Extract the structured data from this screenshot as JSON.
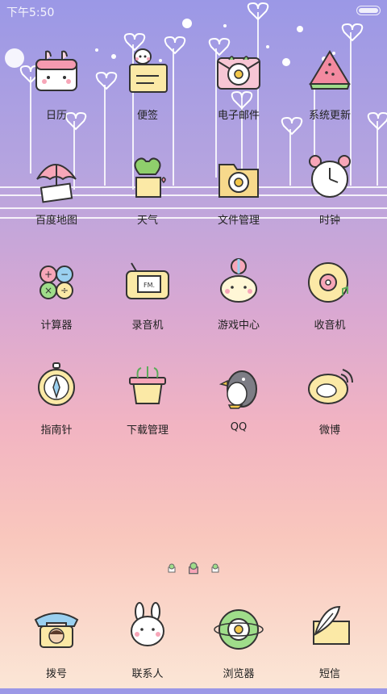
{
  "status_bar": {
    "time": "下午5:50"
  },
  "apps": [
    {
      "id": "calendar",
      "label": "日历",
      "icon": "calendar-icon"
    },
    {
      "id": "notes",
      "label": "便签",
      "icon": "notes-icon"
    },
    {
      "id": "email",
      "label": "电子邮件",
      "icon": "email-icon"
    },
    {
      "id": "system-update",
      "label": "系统更新",
      "icon": "watermelon-icon"
    },
    {
      "id": "baidu-map",
      "label": "百度地图",
      "icon": "umbrella-map-icon"
    },
    {
      "id": "weather",
      "label": "天气",
      "icon": "cactus-icon"
    },
    {
      "id": "file-manager",
      "label": "文件管理",
      "icon": "folder-icon"
    },
    {
      "id": "clock",
      "label": "时钟",
      "icon": "alarm-clock-icon"
    },
    {
      "id": "calculator",
      "label": "计算器",
      "icon": "calculator-icon"
    },
    {
      "id": "recorder",
      "label": "录音机",
      "icon": "radio-icon"
    },
    {
      "id": "game-center",
      "label": "游戏中心",
      "icon": "seal-ball-icon"
    },
    {
      "id": "radio",
      "label": "收音机",
      "icon": "cd-icon"
    },
    {
      "id": "compass",
      "label": "指南针",
      "icon": "compass-icon"
    },
    {
      "id": "download-manager",
      "label": "下载管理",
      "icon": "plant-pot-icon"
    },
    {
      "id": "qq",
      "label": "QQ",
      "icon": "penguin-icon"
    },
    {
      "id": "weibo",
      "label": "微博",
      "icon": "weibo-icon"
    }
  ],
  "dock": [
    {
      "id": "dialer",
      "label": "拨号",
      "icon": "phone-icon"
    },
    {
      "id": "contacts",
      "label": "联系人",
      "icon": "bunny-icon"
    },
    {
      "id": "browser",
      "label": "浏览器",
      "icon": "flower-globe-icon"
    },
    {
      "id": "sms",
      "label": "短信",
      "icon": "feather-letter-icon"
    }
  ],
  "page_indicator": {
    "pages": 3,
    "current": 2
  }
}
